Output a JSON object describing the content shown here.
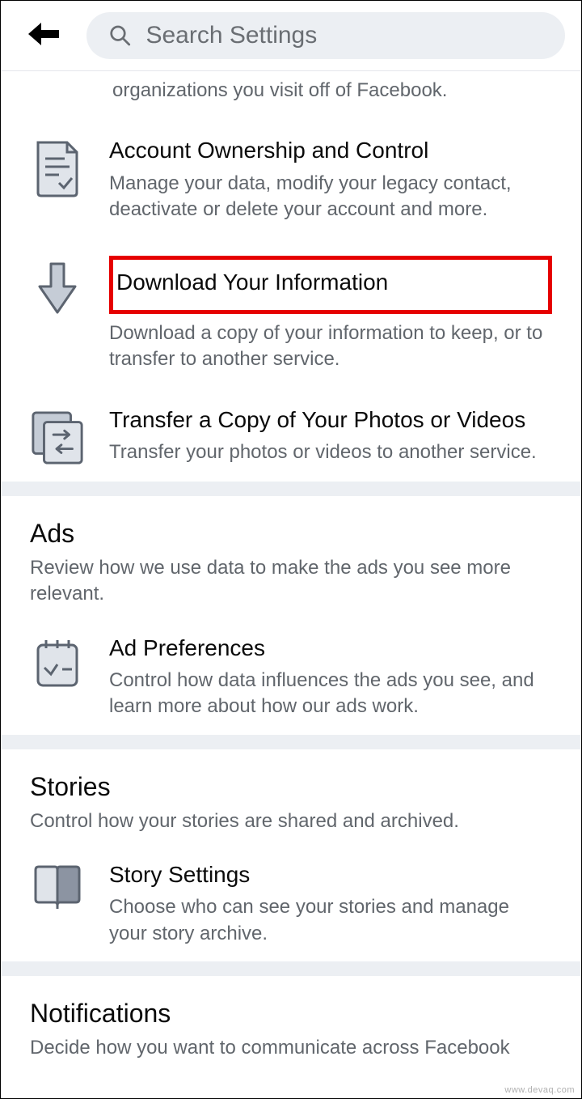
{
  "search": {
    "placeholder": "Search Settings"
  },
  "truncated_top_desc": "organizations you visit off of Facebook.",
  "info_section": {
    "items": [
      {
        "title": "Account Ownership and Control",
        "desc": "Manage your data, modify your legacy contact, deactivate or delete your account and more."
      },
      {
        "title": "Download Your Information",
        "desc": "Download a copy of your information to keep, or to transfer to another service."
      },
      {
        "title": "Transfer a Copy of Your Photos or Videos",
        "desc": "Transfer your photos or videos to another service."
      }
    ]
  },
  "ads_section": {
    "title": "Ads",
    "subtitle": "Review how we use data to make the ads you see more relevant.",
    "items": [
      {
        "title": "Ad Preferences",
        "desc": "Control how data influences the ads you see, and learn more about how our ads work."
      }
    ]
  },
  "stories_section": {
    "title": "Stories",
    "subtitle": "Control how your stories are shared and archived.",
    "items": [
      {
        "title": "Story Settings",
        "desc": "Choose who can see your stories and manage your story archive."
      }
    ]
  },
  "notifications_section": {
    "title": "Notifications",
    "subtitle": "Decide how you want to communicate across Facebook"
  },
  "watermark": "www.devaq.com"
}
